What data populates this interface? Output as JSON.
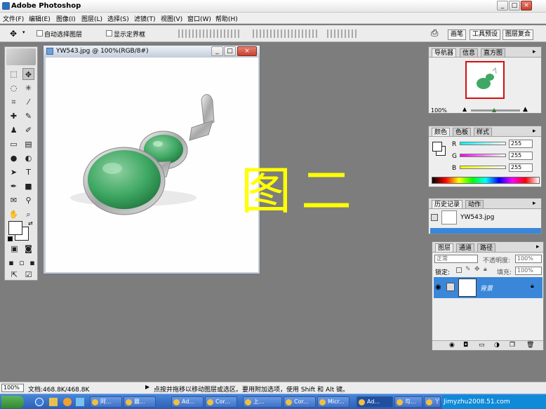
{
  "app": {
    "title": "Adobe Photoshop"
  },
  "window_controls": {
    "minimize": "_",
    "maximize": "□",
    "close": "×"
  },
  "menu": [
    "文件(F)",
    "编辑(E)",
    "图像(I)",
    "图层(L)",
    "选择(S)",
    "滤镜(T)",
    "视图(V)",
    "窗口(W)",
    "帮助(H)"
  ],
  "options": {
    "auto_select": "自动选择图层",
    "show_bounds": "显示定界框"
  },
  "wells": [
    "画笔",
    "工具预设",
    "图层复合"
  ],
  "document": {
    "title": "YW543.jpg @ 100%(RGB/8#)"
  },
  "overlay_text": "图二",
  "navigator": {
    "tabs": [
      "导航器",
      "信息",
      "直方图"
    ],
    "zoom": "100%"
  },
  "color": {
    "tabs": [
      "颜色",
      "色板",
      "样式"
    ],
    "channels": [
      {
        "label": "R",
        "value": "255"
      },
      {
        "label": "G",
        "value": "255"
      },
      {
        "label": "B",
        "value": "255"
      }
    ]
  },
  "history": {
    "tabs": [
      "历史记录",
      "动作"
    ],
    "snapshot": "YW543.jpg"
  },
  "layers": {
    "tabs": [
      "图层",
      "通道",
      "路径"
    ],
    "blend_mode": "正常",
    "opacity_label": "不透明度:",
    "opacity": "100%",
    "lock_label": "锁定:",
    "fill_label": "填充:",
    "fill": "100%",
    "layer_name": "背景"
  },
  "status": {
    "zoom": "100%",
    "doc": "文档:468.8K/468.8K",
    "hint": "点按并拖移以移动图层或选区。要用附加选项，使用 Shift 和 Alt 键。"
  },
  "taskbar": {
    "items": [
      "阿...",
      "晨...",
      "Ad...",
      "Cor...",
      "上...",
      "Cor...",
      "Micr...",
      "Ad...",
      "与...",
      "丫..."
    ],
    "watermark": "Jimyzhu2008.51.com"
  },
  "colors": {
    "accent": "#3a87da",
    "canvas_bg": "#7d7d7d",
    "overlay": "#ffff00"
  }
}
